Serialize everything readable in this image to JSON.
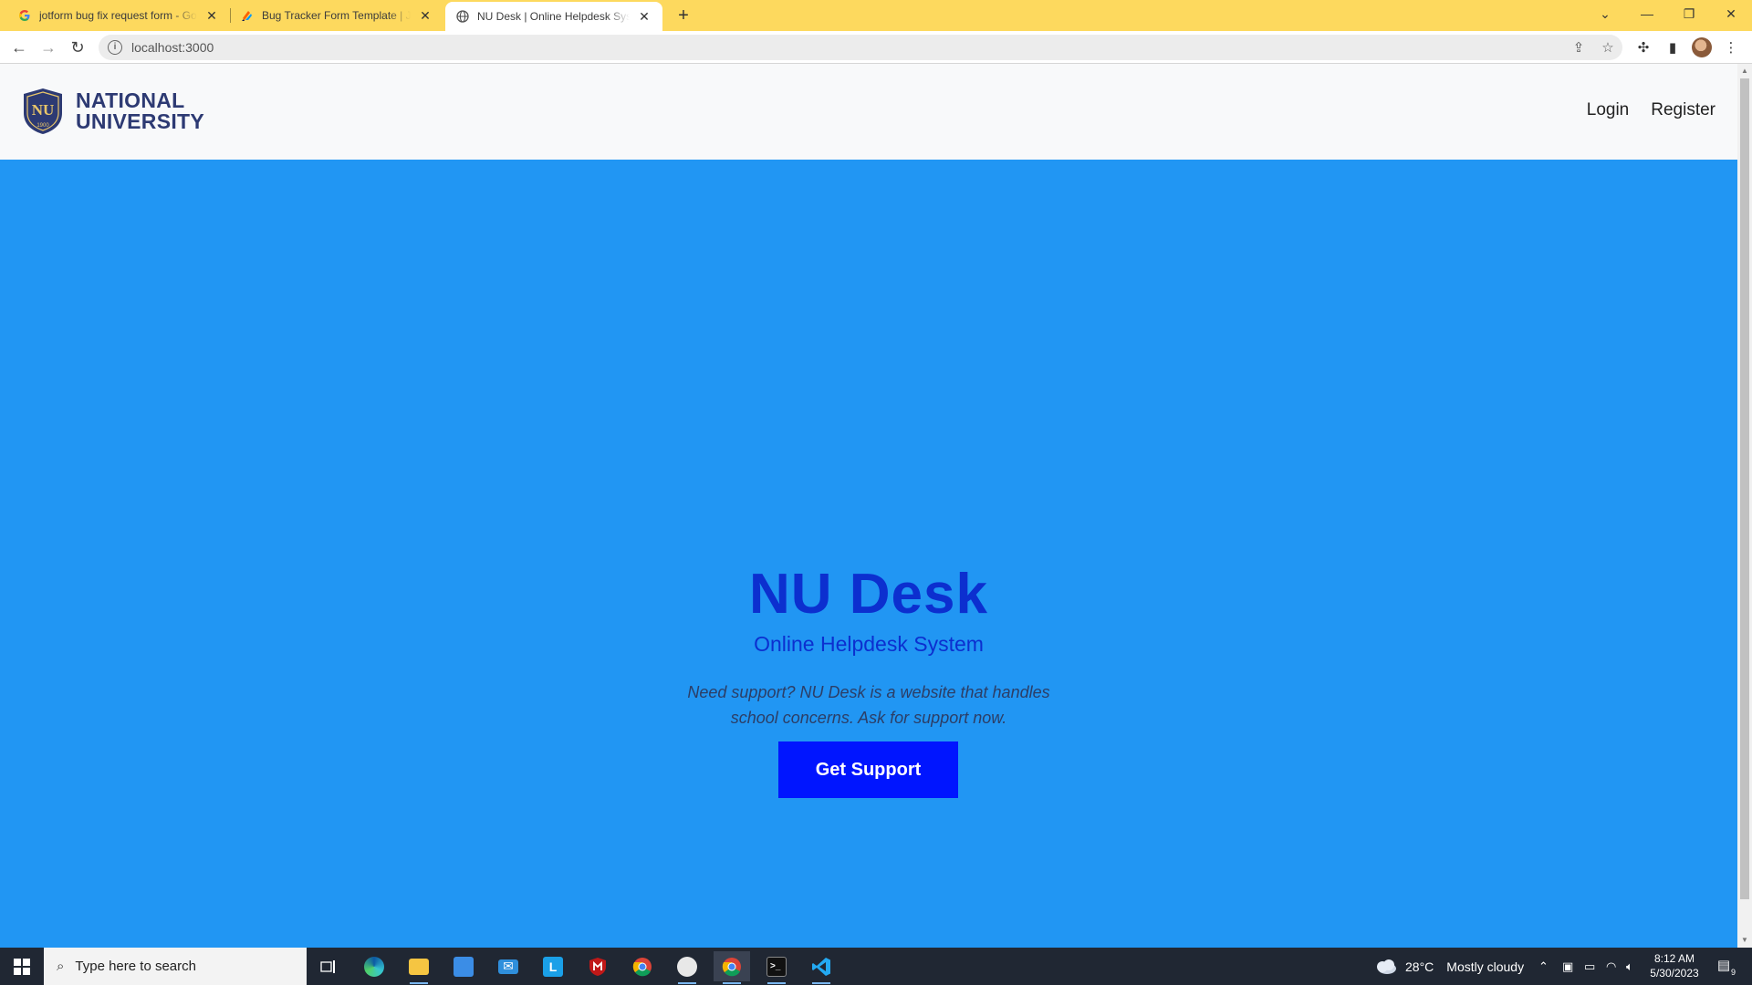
{
  "browser": {
    "tabs": [
      {
        "title": "jotform bug fix request form - Go",
        "favicon": "google-icon"
      },
      {
        "title": "Bug Tracker Form Template | Jotfo",
        "favicon": "jotform-icon"
      },
      {
        "title": "NU Desk | Online Helpdesk System",
        "favicon": "globe-icon",
        "active": true
      }
    ],
    "url": "localhost:3000"
  },
  "header": {
    "brand_line1": "NATIONAL",
    "brand_line2": "UNIVERSITY",
    "crest_text": "NU",
    "crest_year": "1900",
    "nav": {
      "login": "Login",
      "register": "Register"
    }
  },
  "hero": {
    "title": "NU Desk",
    "subtitle": "Online Helpdesk System",
    "description": "Need support? NU Desk is a website that handles school concerns. Ask for support now.",
    "cta_label": "Get Support"
  },
  "taskbar": {
    "search_placeholder": "Type here to search",
    "weather_temp": "28°C",
    "weather_desc": "Mostly cloudy",
    "time": "8:12 AM",
    "date": "5/30/2023",
    "notification_count": "9"
  },
  "colors": {
    "hero_bg": "#2196f3",
    "title": "#0c2fcf",
    "cta_bg": "#0015ff",
    "tabbar": "#fdd95e",
    "brand": "#2d3a73"
  }
}
